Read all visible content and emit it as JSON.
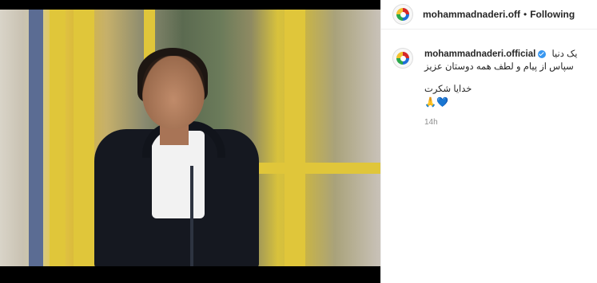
{
  "post": {
    "author": "mohammadnaderi.off",
    "follow_separator": "•",
    "follow_status": "Following"
  },
  "comment": {
    "username": "mohammadnaderi.official",
    "line1": "یک دنیا",
    "line2": "سپاس از پیام و لطف همه دوستان عزیز",
    "line3": "خدایا شکرت",
    "emojis": "🙏💙",
    "time": "14h"
  },
  "icons": {
    "avatar": "team-logo-avatar",
    "verified": "verified-badge-icon"
  },
  "colors": {
    "verified": "#3897f0",
    "text": "#262626",
    "muted": "#8e8e8e"
  }
}
